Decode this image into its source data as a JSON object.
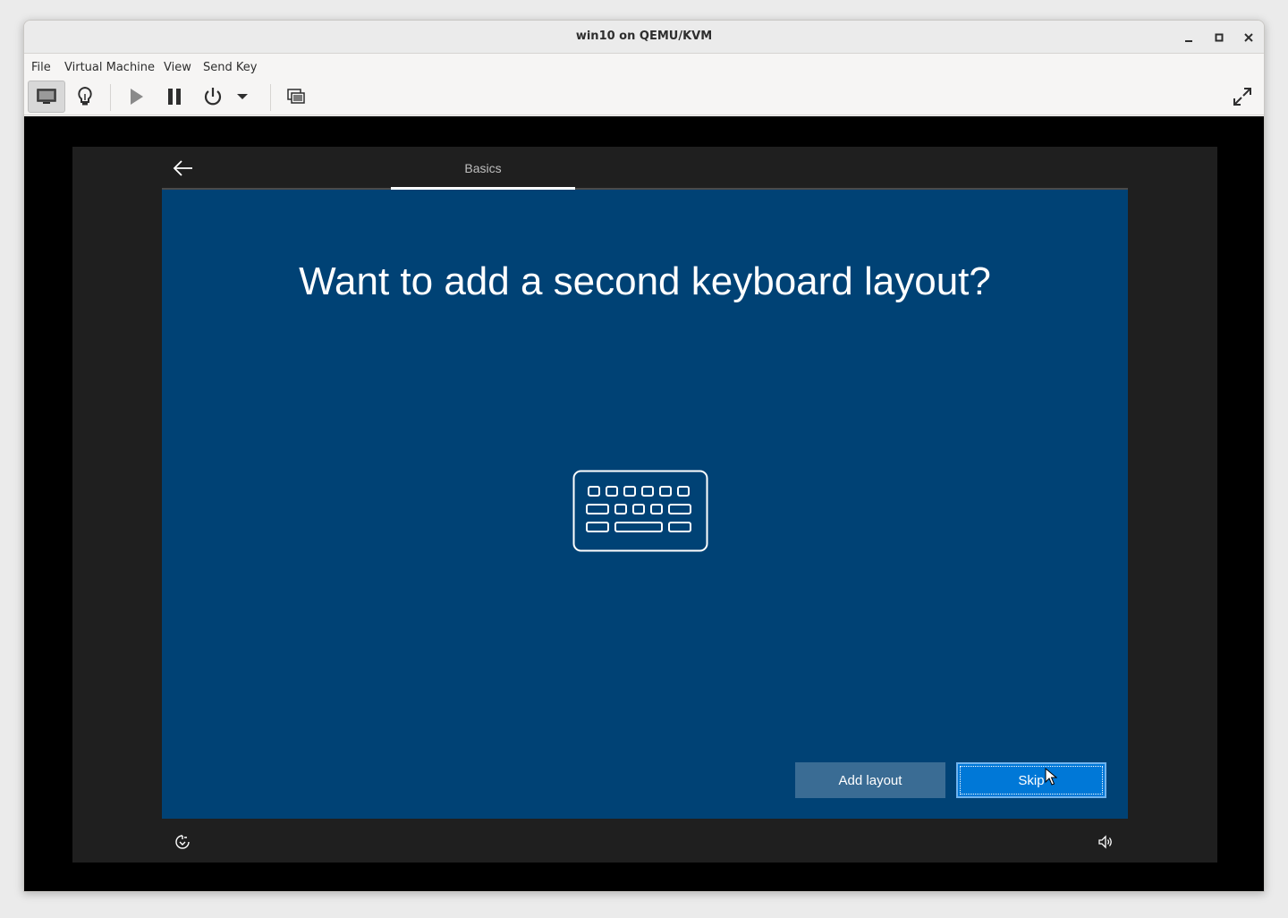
{
  "window": {
    "title": "win10 on QEMU/KVM"
  },
  "menubar": {
    "items": [
      "File",
      "Virtual Machine",
      "View",
      "Send Key"
    ]
  },
  "toolbar": {
    "icons": [
      "monitor-icon",
      "lightbulb-icon",
      "play-icon",
      "pause-icon",
      "power-icon",
      "dropdown-arrow-icon",
      "screenshot-icon",
      "fullscreen-icon"
    ]
  },
  "guest": {
    "tab_label": "Basics",
    "heading": "Want to add a second keyboard layout?",
    "add_layout_label": "Add layout",
    "skip_label": "Skip",
    "background_color": "#004275",
    "accent_color": "#0078d7"
  }
}
